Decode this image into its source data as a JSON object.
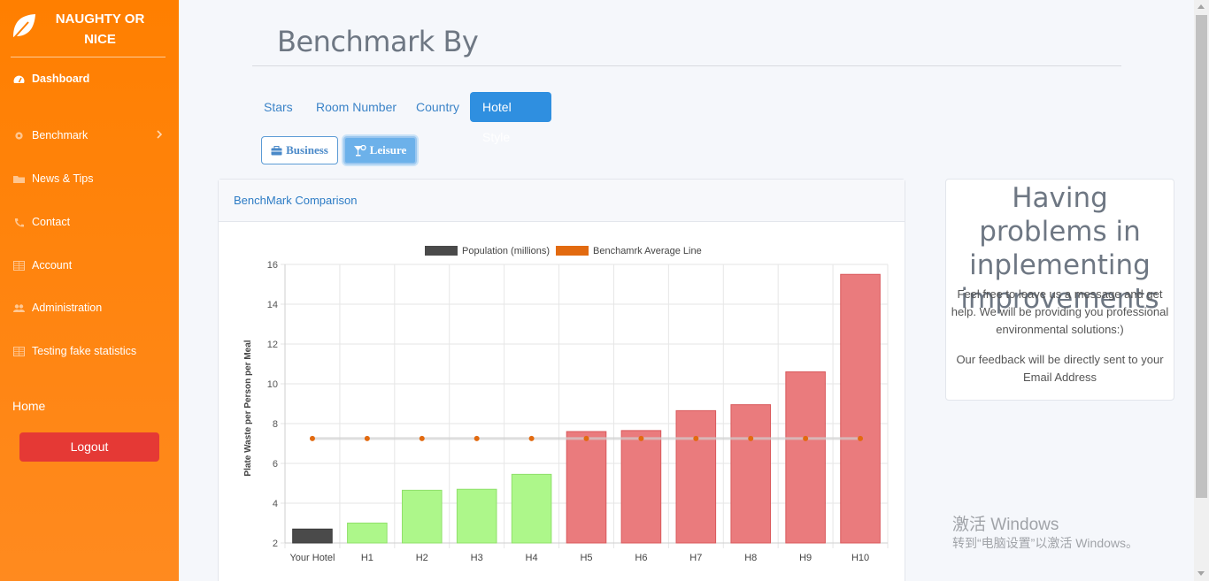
{
  "brand": {
    "line1": "NAUGHTY OR",
    "line2": "NICE",
    "icon": "leaf-icon"
  },
  "sidebar": {
    "items": [
      {
        "label": "Dashboard",
        "icon": "dashboard-icon"
      },
      {
        "label": "Benchmark",
        "icon": "gear-icon"
      },
      {
        "label": "News & Tips",
        "icon": "folder-icon"
      },
      {
        "label": "Contact",
        "icon": "phone-icon"
      },
      {
        "label": "Account",
        "icon": "grid-icon"
      },
      {
        "label": "Administration",
        "icon": "users-icon"
      },
      {
        "label": "Testing fake statistics",
        "icon": "grid-icon"
      }
    ],
    "home": "Home",
    "logout": "Logout"
  },
  "main": {
    "title": "Benchmark By",
    "tabs": [
      "Stars",
      "Room Number",
      "Country",
      "Hotel Style"
    ],
    "active_tab": "Hotel Style",
    "sub_buttons": [
      "Business",
      "Leisure"
    ],
    "active_sub": "Leisure"
  },
  "card": {
    "title": "BenchMark Comparison"
  },
  "help": {
    "title": "Having problems in inplementing improvements",
    "text1": "Feel free to leave us a message and get help. We will be providing you professional environmental solutions:)",
    "text2": "Our feedback will be directly sent to your Email Address"
  },
  "watermark": {
    "line1": "激活 Windows",
    "line2": "转到“电脑设置”以激活 Windows。"
  },
  "colors": {
    "sidebar": "#ff7f00",
    "accent": "#2f8fe0",
    "your_hotel": "#4a4a4a",
    "good": "#adf78a",
    "bad": "#ea7b7d",
    "benchmark": "#e26a10",
    "logout": "#e53935"
  },
  "chart_data": {
    "type": "bar",
    "categories": [
      "Your Hotel",
      "H1",
      "H2",
      "H3",
      "H4",
      "H5",
      "H6",
      "H7",
      "H8",
      "H9",
      "H10"
    ],
    "series": [
      {
        "name": "Population (millions)",
        "type": "bar",
        "values": [
          2.7,
          3.0,
          4.65,
          4.7,
          5.45,
          7.6,
          7.65,
          8.65,
          8.95,
          10.6,
          15.5
        ]
      },
      {
        "name": "Benchamrk Average Line",
        "type": "line",
        "values": [
          7.25,
          7.25,
          7.25,
          7.25,
          7.25,
          7.25,
          7.25,
          7.25,
          7.25,
          7.25,
          7.25
        ]
      }
    ],
    "ylabel": "Plate Waste per Person per Meal",
    "xlabel": "",
    "ylim": [
      2,
      16
    ],
    "yticks": [
      2,
      4,
      6,
      8,
      10,
      12,
      14,
      16
    ],
    "legend": "top",
    "grid": true
  }
}
